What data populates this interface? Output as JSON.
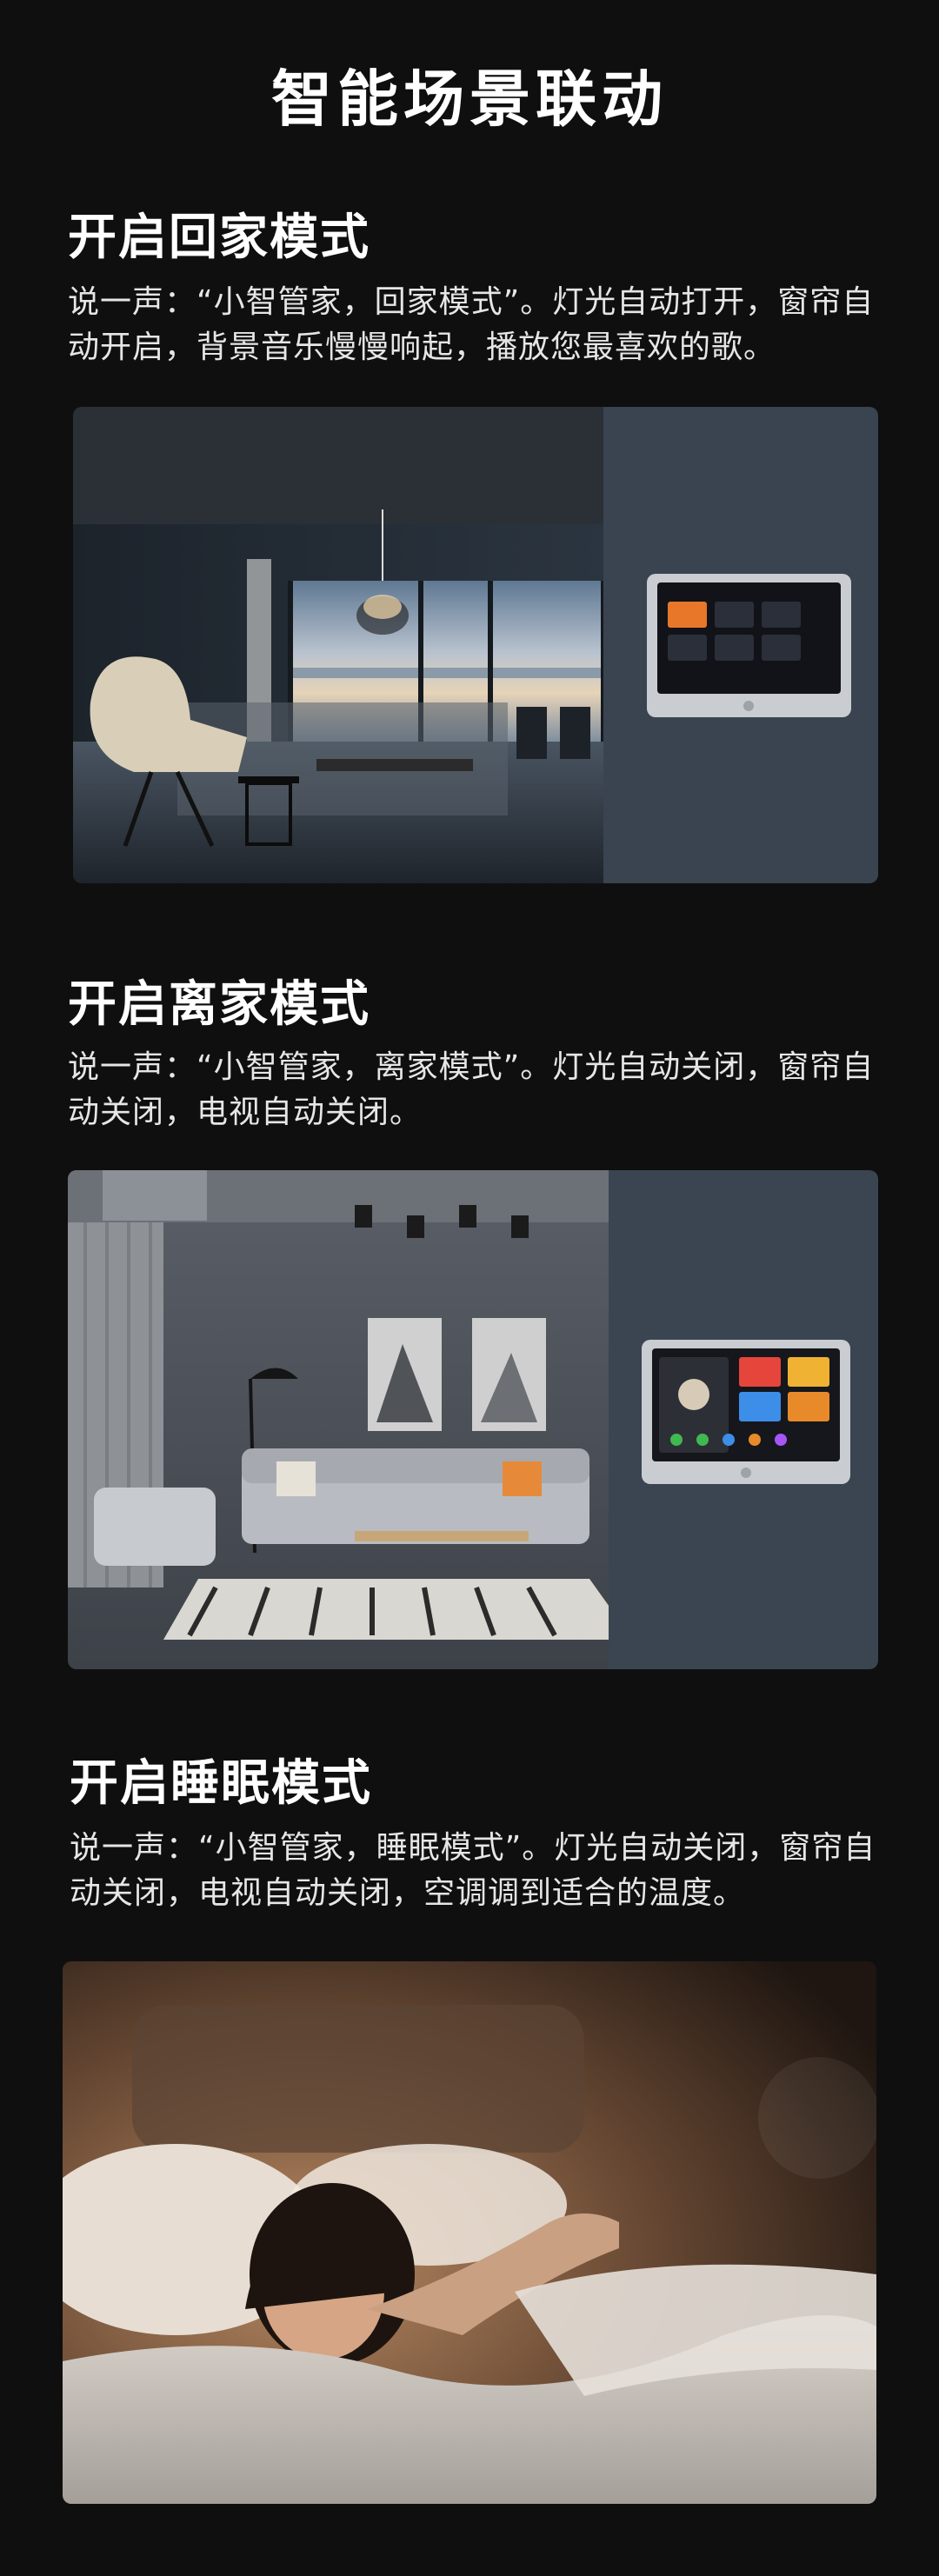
{
  "page": {
    "title": "智能场景联动"
  },
  "sections": [
    {
      "heading": "开启回家模式",
      "desc": "说一声：“小智管家，回家模式”。灯光自动打开，窗帘自动开启，背景音乐慢慢响起，播放您最喜欢的歌。"
    },
    {
      "heading": "开启离家模式",
      "desc": "说一声：“小智管家，离家模式”。灯光自动关闭，窗帘自动关闭，电视自动关闭。"
    },
    {
      "heading": "开启睡眠模式",
      "desc": "说一声：“小智管家，睡眠模式”。灯光自动关闭，窗帘自动关闭，电视自动关闭，空调调到适合的温度。"
    }
  ],
  "colors": {
    "background": "#0f0f0f",
    "wall_panel": "#3a4450",
    "panel_orange": "#e8772a",
    "panel_red": "#e5453b",
    "panel_blue": "#3d8ee8",
    "panel_green": "#3fb950"
  }
}
